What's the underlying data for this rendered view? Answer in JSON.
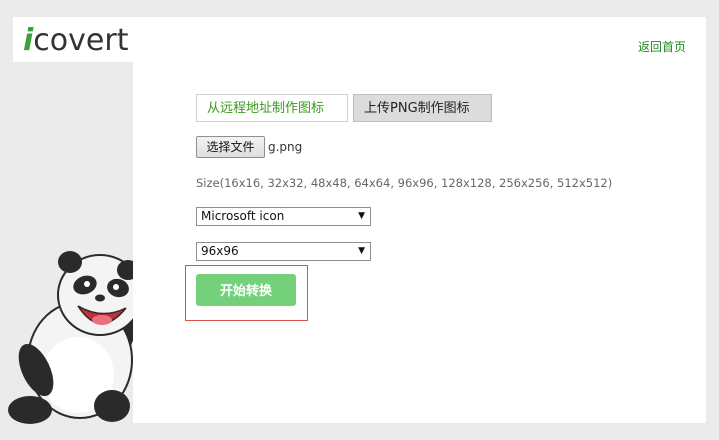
{
  "brand": {
    "logo_i": "i",
    "logo_rest": "covert"
  },
  "header": {
    "home_link": "返回首页"
  },
  "tabs": [
    {
      "label": "从远程地址制作图标",
      "active": false
    },
    {
      "label": "上传PNG制作图标",
      "active": true
    }
  ],
  "upload": {
    "choose_file_label": "选择文件",
    "file_name": "g.png"
  },
  "size_hint": "Size(16x16, 32x32, 48x48, 64x64, 96x96, 128x128, 256x256, 512x512)",
  "format_select": {
    "selected": "Microsoft icon"
  },
  "size_select": {
    "selected": "96x96"
  },
  "convert_button": "开始转换",
  "colors": {
    "accent_green": "#3a9a1c",
    "button_green": "#74d07a",
    "highlight_red": "#d9534f"
  }
}
